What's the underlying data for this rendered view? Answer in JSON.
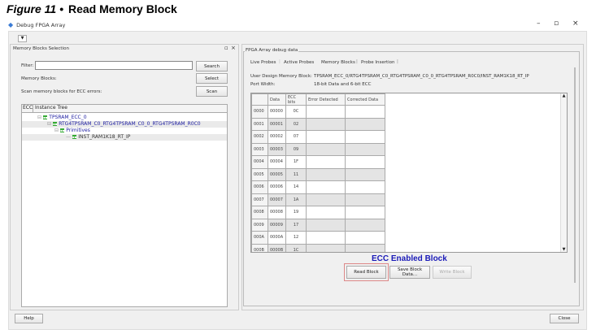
{
  "figure": {
    "number": "Figure 11 •",
    "title": "Read Memory Block"
  },
  "window": {
    "title": "Debug FPGA Array",
    "minimize": "–",
    "maximize": "▫",
    "close": "×"
  },
  "left_panel": {
    "title": "Memory Blocks Selection",
    "filter_label": "Filter:",
    "filter_value": "",
    "search_label": "Search",
    "memory_blocks_label": "Memory Blocks:",
    "select_label": "Select",
    "scan_text": "Scan memory blocks for ECC errors:",
    "scan_label": "Scan",
    "tree_headers": [
      "ECC",
      "Instance Tree"
    ],
    "tree": [
      {
        "label": "TPSRAM_ECC_0",
        "level": 0
      },
      {
        "label": "RTG4TPSRAM_C0_RTG4TPSRAM_C0_0_RTG4TPSRAM_R0C0",
        "level": 1
      },
      {
        "label": "Primitives",
        "level": 2
      },
      {
        "label": "INST_RAM1K18_RT_IP",
        "level": 3
      }
    ]
  },
  "right_panel": {
    "group_title": "FPGA Array debug data",
    "tabs": [
      "Live Probes",
      "Active Probes",
      "Memory Blocks",
      "Probe Insertion"
    ],
    "active_tab": "Memory Blocks",
    "user_design_label": "User Design Memory Block:",
    "user_design_value": "TPSRAM_ECC_0/RTG4TPSRAM_C0_RTG4TPSRAM_C0_0_RTG4TPSRAM_R0C0/INST_RAM1K18_RT_IP",
    "port_width_label": "Port Width:",
    "port_width_value": "18-bit Data and 6-bit ECC",
    "columns": [
      "Data",
      "ECC bits",
      "Error Detected",
      "Corrected Data"
    ],
    "rows": [
      {
        "addr": "0000",
        "data": "00000",
        "ecc": "0C"
      },
      {
        "addr": "0001",
        "data": "00001",
        "ecc": "02"
      },
      {
        "addr": "0002",
        "data": "00002",
        "ecc": "07"
      },
      {
        "addr": "0003",
        "data": "00003",
        "ecc": "09"
      },
      {
        "addr": "0004",
        "data": "00004",
        "ecc": "1F"
      },
      {
        "addr": "0005",
        "data": "00005",
        "ecc": "11"
      },
      {
        "addr": "0006",
        "data": "00006",
        "ecc": "14"
      },
      {
        "addr": "0007",
        "data": "00007",
        "ecc": "1A"
      },
      {
        "addr": "0008",
        "data": "00008",
        "ecc": "19"
      },
      {
        "addr": "0009",
        "data": "00009",
        "ecc": "17"
      },
      {
        "addr": "000A",
        "data": "0000A",
        "ecc": "12"
      },
      {
        "addr": "000B",
        "data": "0000B",
        "ecc": "1C"
      }
    ],
    "annotation": "ECC Enabled Block",
    "read_block": "Read Block",
    "save_block": "Save Block Data...",
    "write_block": "Write Block"
  },
  "footer": {
    "help": "Help",
    "close": "Close"
  }
}
